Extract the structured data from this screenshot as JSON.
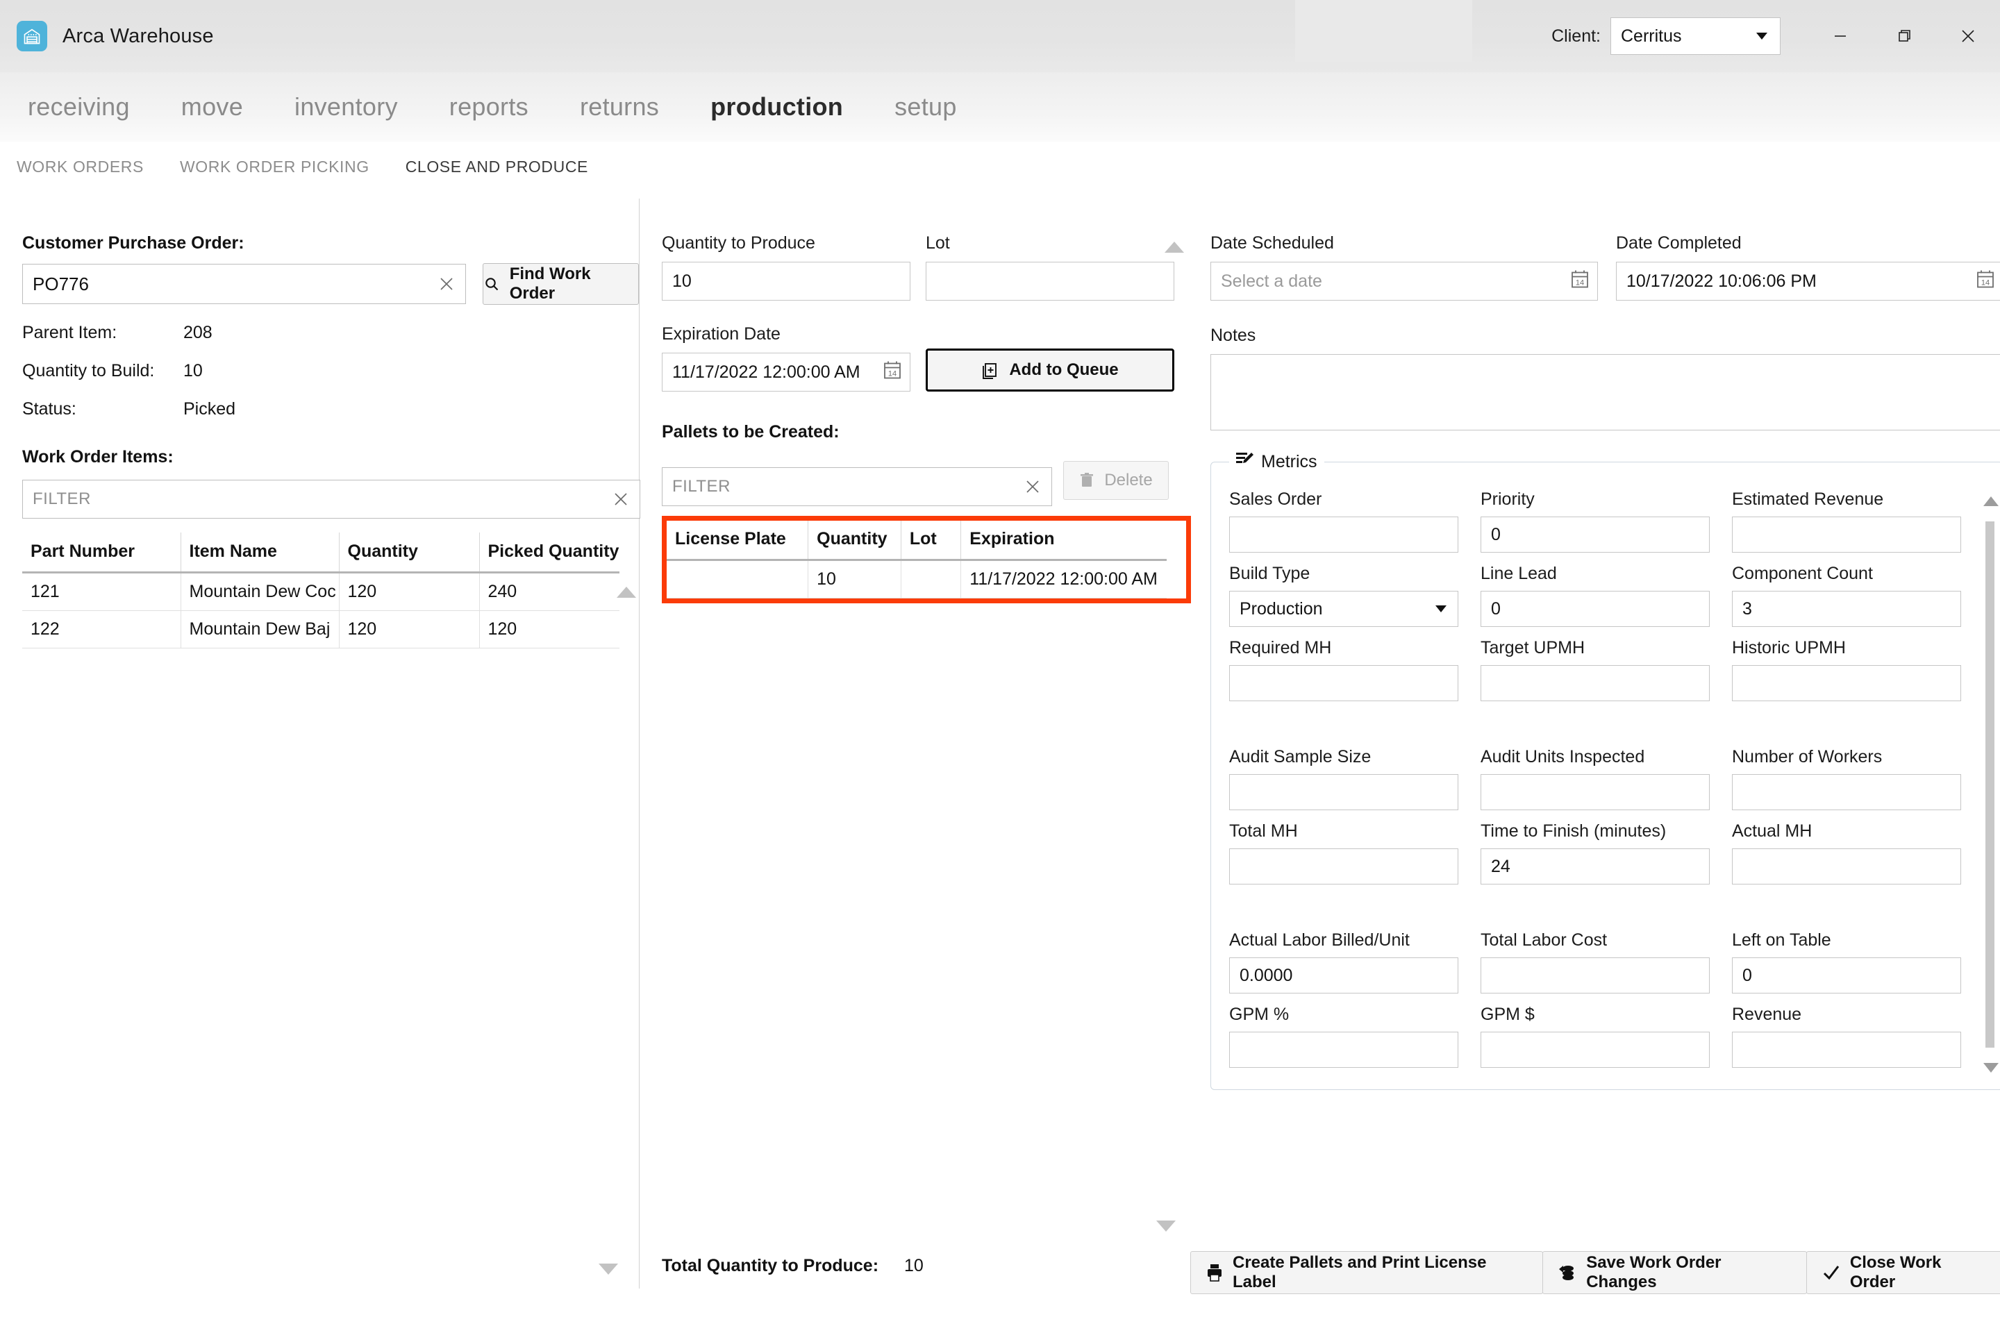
{
  "window": {
    "app_title": "Arca Warehouse",
    "app_icon": "warehouse-icon",
    "client_label": "Client:",
    "client_value": "Cerritus",
    "minimize": "minimize-icon",
    "maximize": "maximize-icon",
    "close": "close-icon"
  },
  "mainnav": {
    "items": [
      {
        "label": "receiving",
        "active": false
      },
      {
        "label": "move",
        "active": false
      },
      {
        "label": "inventory",
        "active": false
      },
      {
        "label": "reports",
        "active": false
      },
      {
        "label": "returns",
        "active": false
      },
      {
        "label": "production",
        "active": true
      },
      {
        "label": "setup",
        "active": false
      }
    ]
  },
  "subnav": {
    "items": [
      {
        "label": "WORK ORDERS",
        "active": false
      },
      {
        "label": "WORK ORDER PICKING",
        "active": false
      },
      {
        "label": "CLOSE AND PRODUCE",
        "active": true
      }
    ]
  },
  "left": {
    "po_label": "Customer Purchase Order:",
    "po_value": "PO776",
    "find_button": "Find Work Order",
    "details": [
      {
        "key": "Parent Item:",
        "value": "208"
      },
      {
        "key": "Quantity to Build:",
        "value": "10"
      },
      {
        "key": "Status:",
        "value": "Picked"
      }
    ],
    "items_label": "Work Order Items:",
    "filter_placeholder": "FILTER",
    "filter_value": "",
    "table": {
      "columns": [
        "Part Number",
        "Item Name",
        "Quantity",
        "Picked Quantity"
      ],
      "rows": [
        [
          "121",
          "Mountain Dew Coc",
          "120",
          "240"
        ],
        [
          "122",
          "Mountain Dew Baj",
          "120",
          "120"
        ]
      ]
    }
  },
  "middle": {
    "qty_label": "Quantity to Produce",
    "qty_value": "10",
    "lot_label": "Lot",
    "lot_value": "",
    "exp_label": "Expiration Date",
    "exp_value": "11/17/2022 12:00:00 AM",
    "add_queue_button": "Add to Queue",
    "pallets_label": "Pallets to be Created:",
    "pal_filter_placeholder": "FILTER",
    "delete_button": "Delete",
    "table": {
      "columns": [
        "License Plate",
        "Quantity",
        "Lot",
        "Expiration"
      ],
      "rows": [
        [
          "",
          "10",
          "",
          "11/17/2022 12:00:00 AM"
        ]
      ]
    },
    "total_label": "Total Quantity to Produce:",
    "total_value": "10",
    "highlight_color": "#fb3b08"
  },
  "right": {
    "date_scheduled_label": "Date Scheduled",
    "date_scheduled_placeholder": "Select a date",
    "date_scheduled_value": "",
    "date_completed_label": "Date Completed",
    "date_completed_value": "10/17/2022 10:06:06 PM",
    "notes_label": "Notes",
    "notes_value": "",
    "metrics_title": "Metrics",
    "metrics_icon": "list-edit-icon",
    "metrics": [
      {
        "label": "Sales Order",
        "value": "",
        "type": "text"
      },
      {
        "label": "Priority",
        "value": "0",
        "type": "text"
      },
      {
        "label": "Estimated Revenue",
        "value": "",
        "type": "text"
      },
      {
        "label": "Build Type",
        "value": "Production",
        "type": "select"
      },
      {
        "label": "Line Lead",
        "value": "0",
        "type": "text"
      },
      {
        "label": "Component Count",
        "value": "3",
        "type": "text"
      },
      {
        "label": "Required MH",
        "value": "",
        "type": "text"
      },
      {
        "label": "Target UPMH",
        "value": "",
        "type": "text"
      },
      {
        "label": "Historic UPMH",
        "value": "",
        "type": "text"
      },
      {
        "label": "Audit Sample Size",
        "value": "",
        "type": "text"
      },
      {
        "label": "Audit Units Inspected",
        "value": "",
        "type": "text"
      },
      {
        "label": "Number of Workers",
        "value": "",
        "type": "text"
      },
      {
        "label": "Total MH",
        "value": "",
        "type": "text"
      },
      {
        "label": "Time to Finish (minutes)",
        "value": "24",
        "type": "text"
      },
      {
        "label": "Actual MH",
        "value": "",
        "type": "text"
      },
      {
        "label": "Actual Labor Billed/Unit",
        "value": "0.0000",
        "type": "text"
      },
      {
        "label": "Total Labor Cost",
        "value": "",
        "type": "text"
      },
      {
        "label": "Left on Table",
        "value": "0",
        "type": "text"
      },
      {
        "label": "GPM %",
        "value": "",
        "type": "text"
      },
      {
        "label": "GPM $",
        "value": "",
        "type": "text"
      },
      {
        "label": "Revenue",
        "value": "",
        "type": "text"
      }
    ]
  },
  "bottom": {
    "buttons": [
      {
        "label": "Create Pallets and Print License Label",
        "icon": "printer-icon"
      },
      {
        "label": "Save Work Order Changes",
        "icon": "save-stack-icon"
      },
      {
        "label": "Close Work Order",
        "icon": "check-icon"
      }
    ]
  }
}
